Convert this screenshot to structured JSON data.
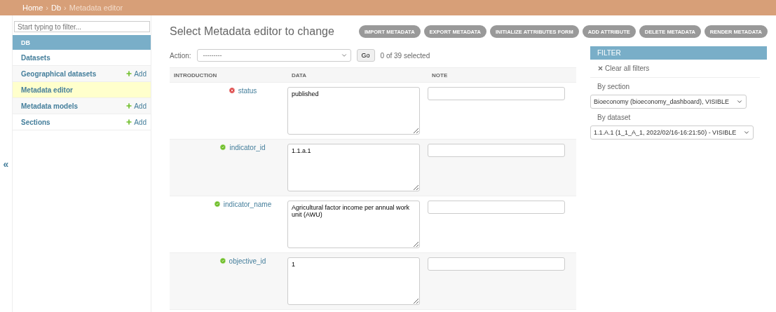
{
  "breadcrumb_separator": "›",
  "breadcrumbs": [
    {
      "label": "Home",
      "link": true
    },
    {
      "label": "Db",
      "link": true
    },
    {
      "label": "Metadata editor",
      "link": false
    }
  ],
  "sidebar": {
    "filter_placeholder": "Start typing to filter...",
    "module": "DB",
    "items": [
      {
        "label": "Datasets",
        "selected": false
      },
      {
        "label": "Geographical datasets",
        "selected": false,
        "add": "Add"
      },
      {
        "label": "Metadata editor",
        "selected": true
      },
      {
        "label": "Metadata models",
        "selected": false,
        "add": "Add"
      },
      {
        "label": "Sections",
        "selected": false,
        "add": "Add"
      }
    ],
    "collapse": "«"
  },
  "title": "Select Metadata editor to change",
  "tools": [
    "IMPORT METADATA",
    "EXPORT METADATA",
    "INITIALIZE ATTRIBUTES FORM",
    "ADD ATTRIBUTE",
    "DELETE METADATA",
    "RENDER METADATA"
  ],
  "actions": {
    "label": "Action:",
    "value": "---------",
    "go": "Go",
    "counter": "0 of 39 selected"
  },
  "table": {
    "columns": [
      "INTRODUCTION",
      "DATA",
      "NOTE"
    ],
    "rows": [
      {
        "name": "status",
        "valid": false,
        "data": "published"
      },
      {
        "name": "indicator_id",
        "valid": true,
        "data": "1.1.a.1"
      },
      {
        "name": "indicator_name",
        "valid": true,
        "data": "Agricultural factor income per annual work unit (AWU)"
      },
      {
        "name": "objective_id",
        "valid": true,
        "data": "1"
      }
    ]
  },
  "filter": {
    "title": "FILTER",
    "clear": "Clear all filters",
    "groups": [
      {
        "label": "By section",
        "value": "Bioeconomy (bioeconomy_dashboard), VISIBLE"
      },
      {
        "label": "By dataset",
        "value": "1.1.A.1 (1_1_A_1, 2022/02/16-16:21:50) - VISIBLE"
      }
    ]
  }
}
